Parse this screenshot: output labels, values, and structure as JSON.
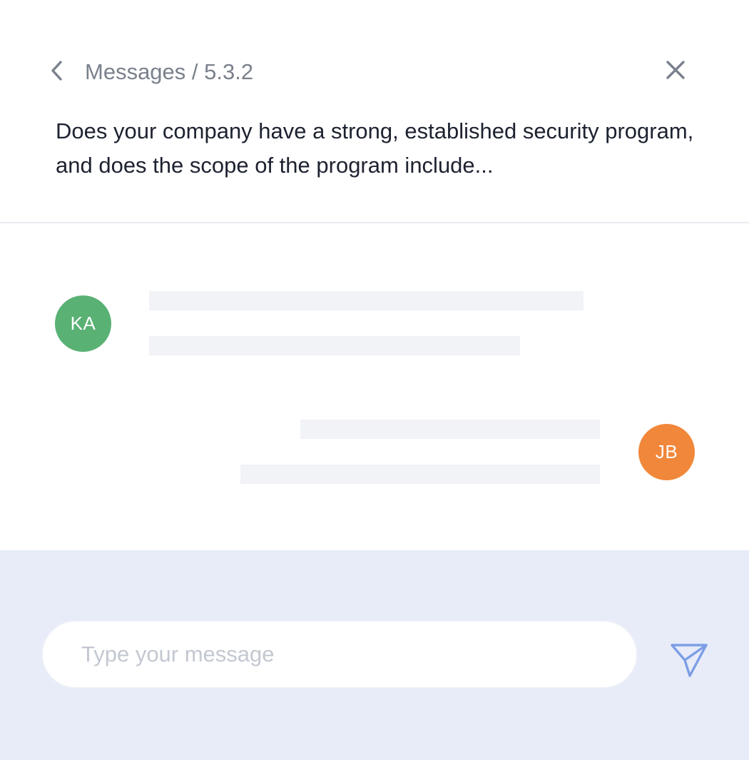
{
  "header": {
    "breadcrumb": "Messages / 5.3.2",
    "back_icon": "chevron-left-icon",
    "close_icon": "close-icon",
    "question": "Does your company have a strong, established security program, and does the scope of the program include..."
  },
  "thread": {
    "messages": [
      {
        "sender_initials": "KA",
        "avatar_color": "#59b174",
        "side": "left"
      },
      {
        "sender_initials": "JB",
        "avatar_color": "#f1873a",
        "side": "right"
      }
    ],
    "placeholder_line_color": "#f1f3f7"
  },
  "composer": {
    "input_value": "",
    "placeholder": "Type your message",
    "send_icon": "send-icon",
    "background": "#e7ecf8",
    "accent": "#7d9ee5"
  }
}
